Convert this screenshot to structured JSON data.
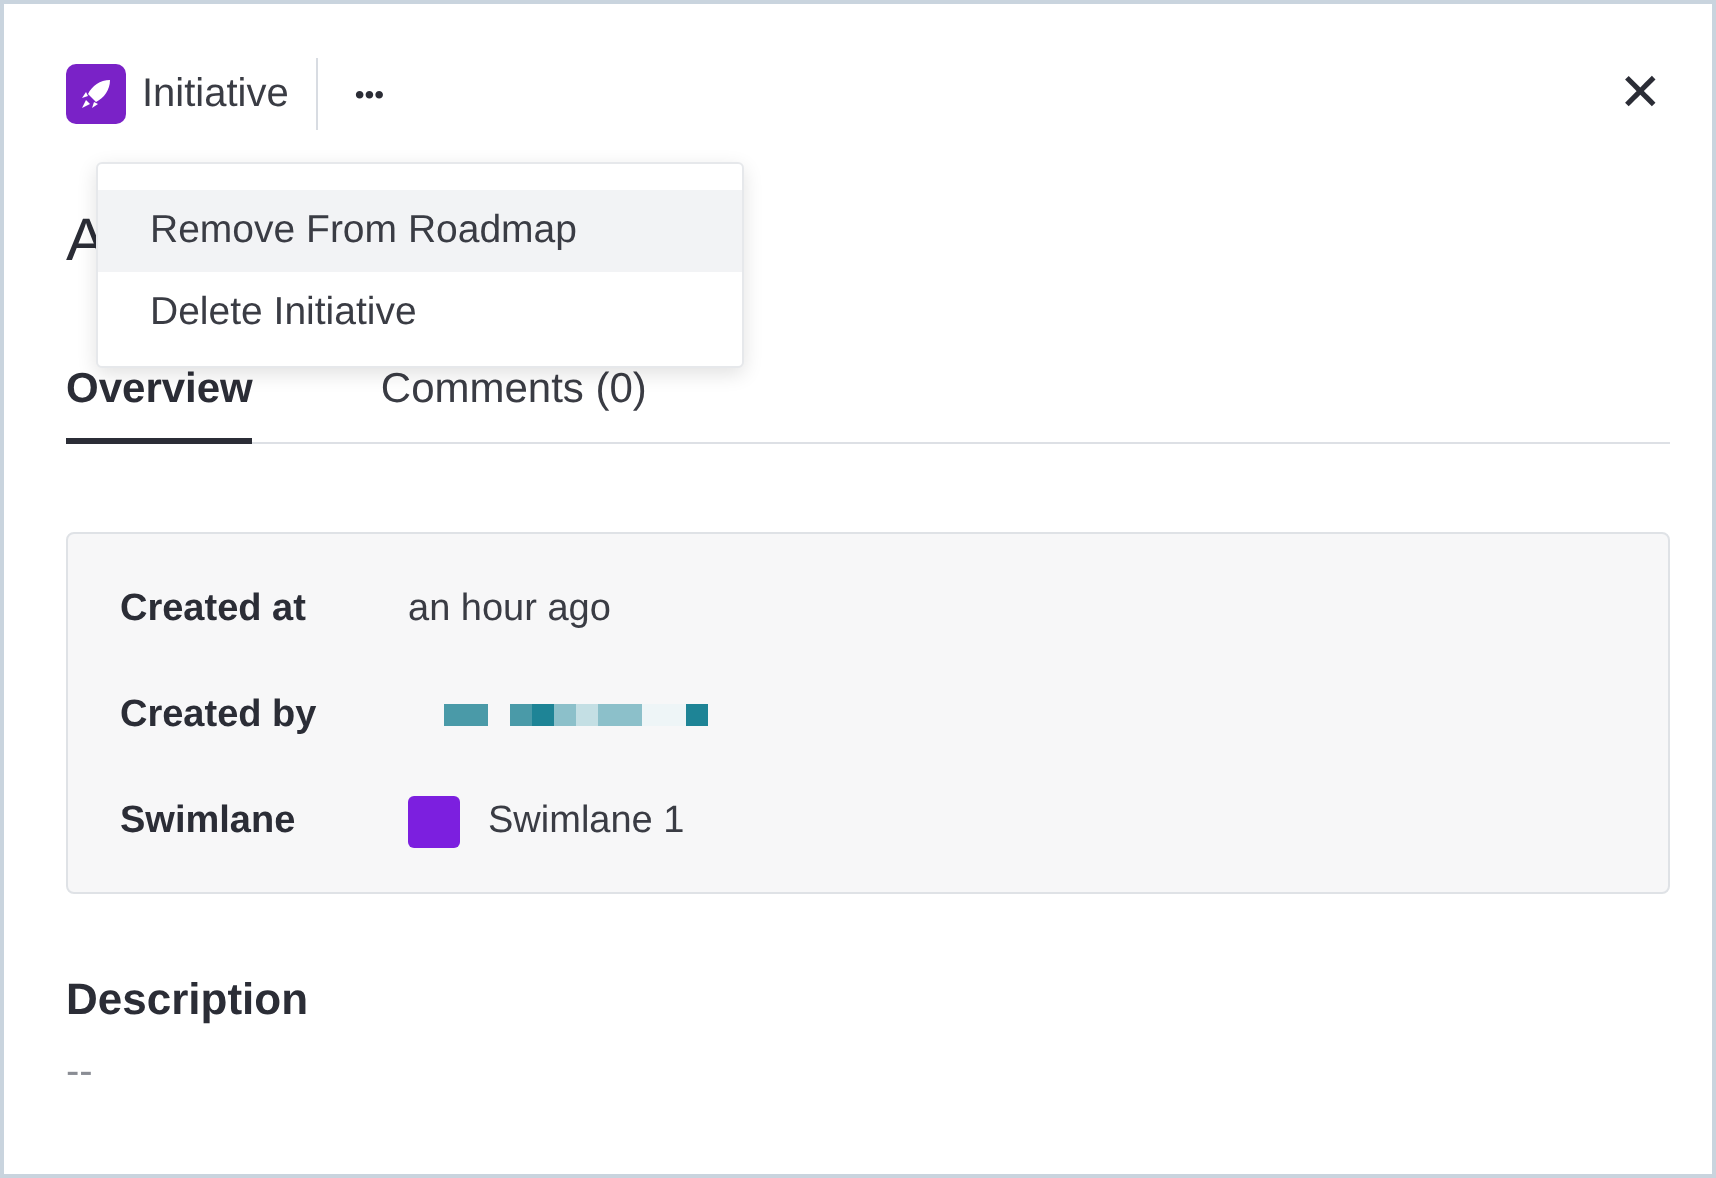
{
  "header": {
    "type_label": "Initiative",
    "more": "•••",
    "close": "✕"
  },
  "menu": {
    "items": [
      {
        "label": "Remove From Roadmap",
        "selected": true
      },
      {
        "label": "Delete Initiative",
        "selected": false
      }
    ]
  },
  "title": "A",
  "tabs": [
    {
      "label": "Overview",
      "selected": true
    },
    {
      "label": "Comments (0)",
      "selected": false
    }
  ],
  "details": [
    {
      "label": "Created at",
      "kind": "text",
      "value": "an hour ago"
    },
    {
      "label": "Created by",
      "kind": "redacted"
    },
    {
      "label": "Swimlane",
      "kind": "swatch",
      "value": "Swimlane 1",
      "color": "#7c1fdf"
    }
  ],
  "description": {
    "heading": "Description",
    "value": "--"
  }
}
